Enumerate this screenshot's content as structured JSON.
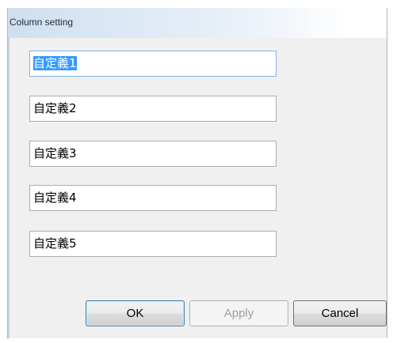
{
  "window": {
    "title": "Column setting"
  },
  "fields": [
    {
      "value": "自定義1"
    },
    {
      "value": "自定義2"
    },
    {
      "value": "自定義3"
    },
    {
      "value": "自定義4"
    },
    {
      "value": "自定義5"
    }
  ],
  "buttons": {
    "ok_label": "OK",
    "apply_label": "Apply",
    "cancel_label": "Cancel"
  }
}
